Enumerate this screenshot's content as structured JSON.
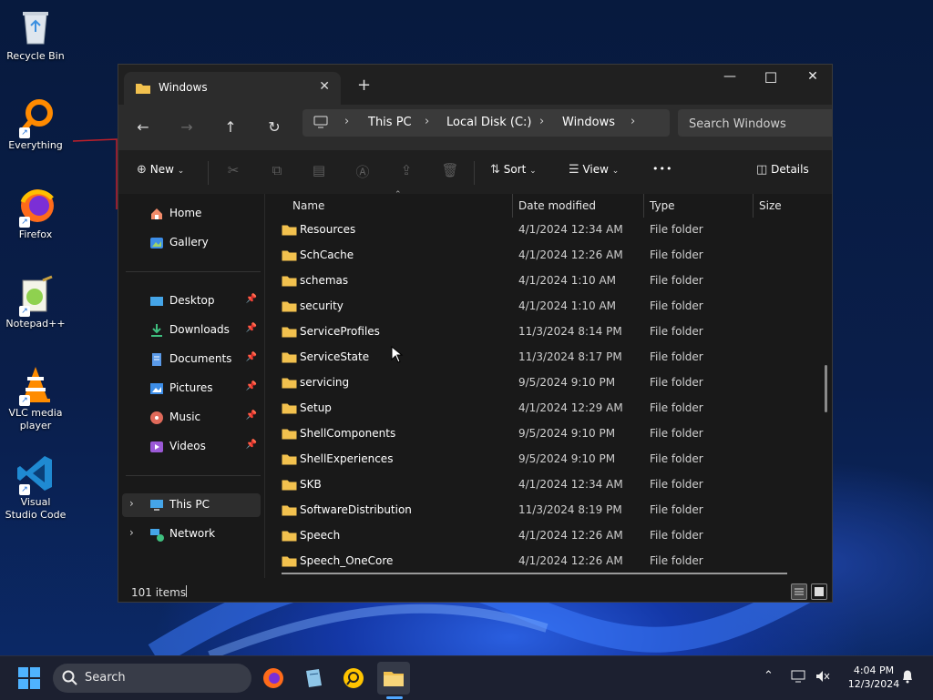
{
  "desktop": {
    "icons": [
      {
        "label": "Recycle Bin"
      },
      {
        "label": "Everything"
      },
      {
        "label": "Firefox"
      },
      {
        "label": "Notepad++"
      },
      {
        "label": "VLC media player"
      },
      {
        "label": "Visual Studio Code"
      }
    ]
  },
  "window": {
    "tab_title": "Windows",
    "tab_close": "✕",
    "new_tab": "+",
    "controls": {
      "minimize": "—",
      "maximize": "☐",
      "close": "✕"
    }
  },
  "nav": {
    "back": "←",
    "forward": "→",
    "up": "↑",
    "refresh": "↻",
    "breadcrumb": [
      "This PC",
      "Local Disk (C:)",
      "Windows"
    ],
    "search_placeholder": "Search Windows"
  },
  "commandbar": {
    "new_label": "New",
    "sort_label": "Sort",
    "view_label": "View",
    "more_label": "•••",
    "details_label": "Details"
  },
  "sidebar": {
    "home": "Home",
    "gallery": "Gallery",
    "quick": [
      "Desktop",
      "Downloads",
      "Documents",
      "Pictures",
      "Music",
      "Videos"
    ],
    "this_pc": "This PC",
    "network": "Network"
  },
  "columns": {
    "name": "Name",
    "date": "Date modified",
    "type": "Type",
    "size": "Size"
  },
  "files": [
    {
      "name": "Resources",
      "date": "4/1/2024 12:34 AM",
      "type": "File folder"
    },
    {
      "name": "SchCache",
      "date": "4/1/2024 12:26 AM",
      "type": "File folder"
    },
    {
      "name": "schemas",
      "date": "4/1/2024 1:10 AM",
      "type": "File folder"
    },
    {
      "name": "security",
      "date": "4/1/2024 1:10 AM",
      "type": "File folder"
    },
    {
      "name": "ServiceProfiles",
      "date": "11/3/2024 8:14 PM",
      "type": "File folder"
    },
    {
      "name": "ServiceState",
      "date": "11/3/2024 8:17 PM",
      "type": "File folder"
    },
    {
      "name": "servicing",
      "date": "9/5/2024 9:10 PM",
      "type": "File folder"
    },
    {
      "name": "Setup",
      "date": "4/1/2024 12:29 AM",
      "type": "File folder"
    },
    {
      "name": "ShellComponents",
      "date": "9/5/2024 9:10 PM",
      "type": "File folder"
    },
    {
      "name": "ShellExperiences",
      "date": "9/5/2024 9:10 PM",
      "type": "File folder"
    },
    {
      "name": "SKB",
      "date": "4/1/2024 12:34 AM",
      "type": "File folder"
    },
    {
      "name": "SoftwareDistribution",
      "date": "11/3/2024 8:19 PM",
      "type": "File folder"
    },
    {
      "name": "Speech",
      "date": "4/1/2024 12:26 AM",
      "type": "File folder"
    },
    {
      "name": "Speech_OneCore",
      "date": "4/1/2024 12:26 AM",
      "type": "File folder"
    }
  ],
  "status": {
    "item_count": "101 items"
  },
  "taskbar": {
    "search_label": "Search",
    "time": "4:04 PM",
    "date": "12/3/2024"
  },
  "colors": {
    "folder": "#f2c14e",
    "accent": "#4fa7ff"
  }
}
